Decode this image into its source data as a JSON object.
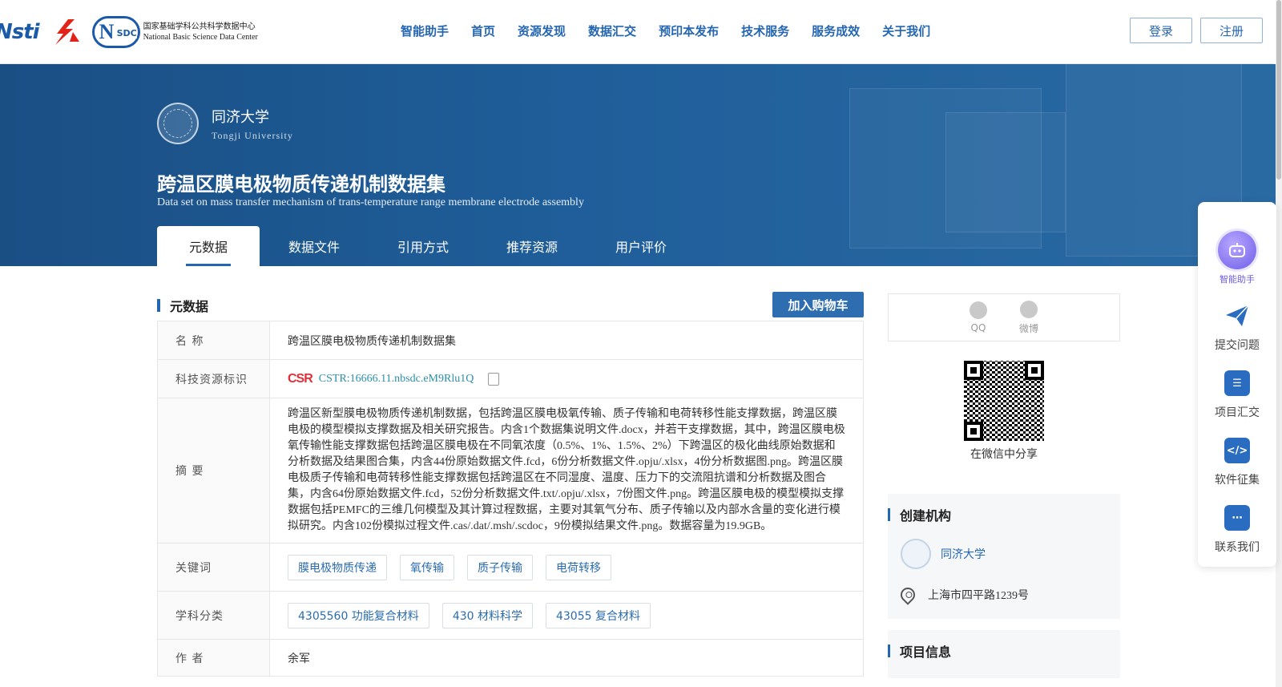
{
  "header": {
    "logos": {
      "nsti": "Nsti",
      "nsdc_cn": "国家基础学科公共科学数据中心",
      "nsdc_en": "National Basic Science Data Center",
      "nsdc_abbr": "SDC"
    },
    "nav": [
      "智能助手",
      "首页",
      "资源发现",
      "数据汇交",
      "预印本发布",
      "技术服务",
      "服务成效",
      "关于我们"
    ],
    "login": "登录",
    "register": "注册"
  },
  "banner": {
    "institution": "同济大学",
    "institution_en": "Tongji University",
    "title": "跨温区膜电极物质传递机制数据集",
    "subtitle": "Data set on mass transfer mechanism of trans-temperature range membrane electrode assembly",
    "tabs": [
      "元数据",
      "数据文件",
      "引用方式",
      "推荐资源",
      "用户评价"
    ],
    "active_tab": "元数据"
  },
  "metadata": {
    "section_title": "元数据",
    "cart_button": "加入购物车",
    "rows": {
      "name_label": "名  称",
      "name_value": "跨温区膜电极物质传递机制数据集",
      "id_label": "科技资源标识",
      "id_value": "CSTR:16666.11.nbsdc.eM9Rlu1Q",
      "id_logo": "CSR",
      "abstract_label": "摘  要",
      "abstract_value": "跨温区新型膜电极物质传递机制数据，包括跨温区膜电极氧传输、质子传输和电荷转移性能支撑数据，跨温区膜电极的模型模拟支撑数据及相关研究报告。内含1个数据集说明文件.docx，并若干支撑数据，其中，跨温区膜电极氧传输性能支撑数据包括跨温区膜电极在不同氧浓度（0.5%、1%、1.5%、2%）下跨温区的极化曲线原始数据和分析数据及结果图合集，内含44份原始数据文件.fcd，6份分析数据文件.opju/.xlsx，4份分析数据图.png。跨温区膜电极质子传输和电荷转移性能支撑数据包括跨温区在不同湿度、温度、压力下的交流阻抗谱和分析数据及图合集，内含64份原始数据文件.fcd，52份分析数据文件.txt/.opju/.xlsx，7份图文件.png。跨温区膜电极的模型模拟支撑数据包括PEMFC的三维几何模型及其计算过程数据，主要对其氧气分布、质子传输以及内部水含量的变化进行模拟研究。内含102份模拟过程文件.cas/.dat/.msh/.scdoc，9份模拟结果文件.png。数据容量为19.9GB。",
      "keywords_label": "关键词",
      "keywords": [
        "膜电极物质传递",
        "氧传输",
        "质子传输",
        "电荷转移"
      ],
      "subject_label": "学科分类",
      "subjects": [
        "4305560 功能复合材料",
        "430 材料科学",
        "43055 复合材料"
      ],
      "author_label": "作  者",
      "author_value": "余军"
    }
  },
  "sidebar": {
    "share_qq": "QQ",
    "share_weibo": "微博",
    "wechat_share": "在微信中分享",
    "org_section": "创建机构",
    "org_name": "同济大学",
    "org_address": "上海市四平路1239号",
    "project_section": "项目信息"
  },
  "float_menu": {
    "ai": "智能助手",
    "items": [
      "提交问题",
      "项目汇交",
      "软件征集",
      "联系我们"
    ]
  },
  "colors": {
    "brand": "#2566b2",
    "banner": "#1f5e9a",
    "cart": "#2e6db0"
  }
}
